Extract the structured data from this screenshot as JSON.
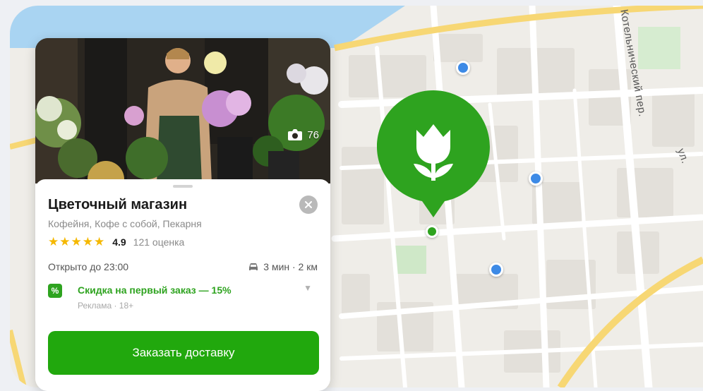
{
  "map": {
    "street_labels": [
      "Котельнический пер.",
      "ул."
    ],
    "poi_color": "#3d8ae6"
  },
  "place_pin": {
    "icon": "tulip-icon",
    "color": "#2ea31f"
  },
  "card": {
    "photo_count": "76",
    "title": "Цветочный магазин",
    "categories": "Кофейня, Кофе с собой, Пекарня",
    "stars": "★★★★★",
    "rating": "4.9",
    "reviews": "121 оценка",
    "hours": "Открыто до 23:00",
    "route": "3 мин · 2 км",
    "promo": {
      "text": "Скидка на первый заказ — 15%",
      "ad_label": "Реклама · 18+"
    },
    "order_button": "Заказать доставку",
    "accent_color": "#21a80d"
  }
}
